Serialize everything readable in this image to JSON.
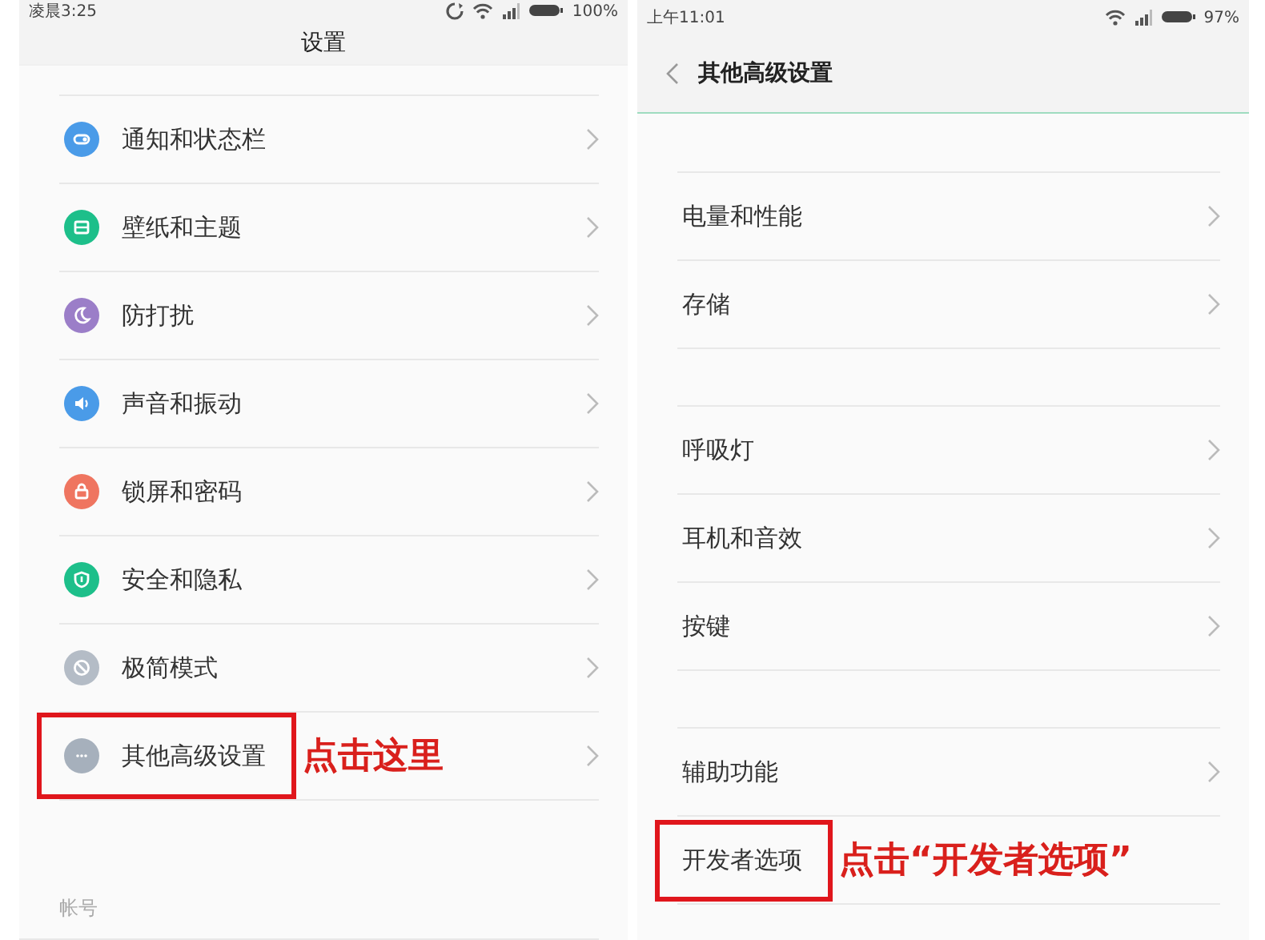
{
  "screens": [
    {
      "status_bar": {
        "time": "凌晨3:25",
        "icons": [
          {
            "kind": "sync"
          },
          {
            "kind": "wifi"
          },
          {
            "kind": "signal"
          },
          {
            "kind": "battery"
          }
        ],
        "battery": "100%"
      },
      "header": {
        "title": "设置",
        "back": false,
        "edge_glow": false
      },
      "groups": [
        {
          "items": [
            {
              "label": "通知和状态栏",
              "kind": "toggle",
              "color": "#4a9be8",
              "chevron": true,
              "highlighted": false
            },
            {
              "label": "壁纸和主题",
              "kind": "image",
              "color": "#1dbf8a",
              "chevron": true,
              "highlighted": false
            },
            {
              "label": "防打扰",
              "kind": "moon",
              "color": "#9b7ec8",
              "chevron": true,
              "highlighted": false
            },
            {
              "label": "声音和振动",
              "kind": "speaker",
              "color": "#4a9be8",
              "chevron": true,
              "highlighted": false
            },
            {
              "label": "锁屏和密码",
              "kind": "lock",
              "color": "#ef7560",
              "chevron": true,
              "highlighted": false
            },
            {
              "label": "安全和隐私",
              "kind": "shield",
              "color": "#1dbf8a",
              "chevron": true,
              "highlighted": false
            },
            {
              "label": "极简模式",
              "kind": "ban",
              "color": "#b4bcc6",
              "chevron": true,
              "highlighted": false
            },
            {
              "label": "其他高级设置",
              "kind": "dots",
              "color": "#a6b0bc",
              "chevron": true,
              "highlighted": true,
              "note": "点击这里"
            }
          ]
        },
        {
          "title": "帐号"
        }
      ]
    },
    {
      "status_bar": {
        "time": "上午11:01",
        "icons": [
          {
            "kind": "wifi"
          },
          {
            "kind": "signal"
          },
          {
            "kind": "battery"
          }
        ],
        "battery": "97%"
      },
      "header": {
        "title": "其他高级设置",
        "back": true,
        "edge_glow": true
      },
      "groups": [
        {
          "items": [
            {
              "label": "电量和性能",
              "chevron": true,
              "highlighted": false
            },
            {
              "label": "存储",
              "chevron": true,
              "highlighted": false
            }
          ]
        },
        {
          "items": [
            {
              "label": "呼吸灯",
              "chevron": true,
              "highlighted": false
            },
            {
              "label": "耳机和音效",
              "chevron": true,
              "highlighted": false
            },
            {
              "label": "按键",
              "chevron": true,
              "highlighted": false
            }
          ]
        },
        {
          "items": [
            {
              "label": "辅助功能",
              "chevron": true,
              "highlighted": false
            },
            {
              "label": "开发者选项",
              "chevron": false,
              "highlighted": true,
              "note": "点击“开发者选项”"
            }
          ]
        }
      ]
    }
  ]
}
